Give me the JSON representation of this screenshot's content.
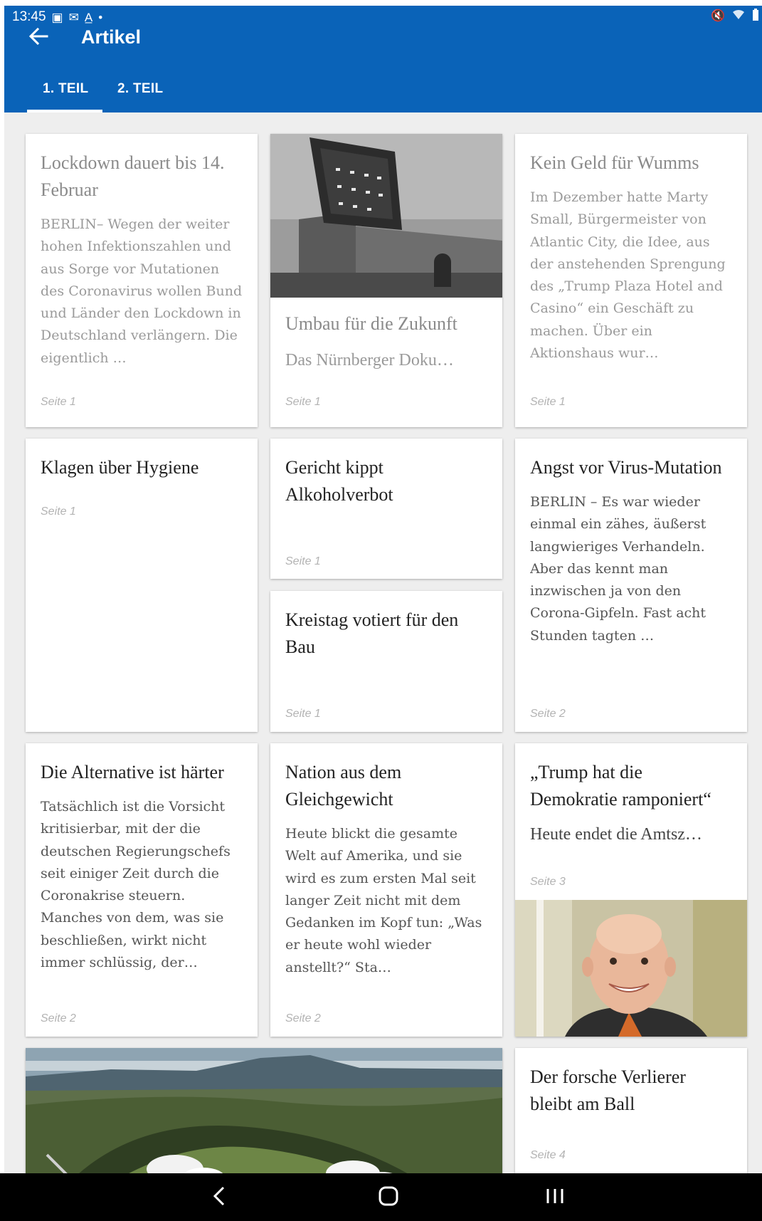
{
  "status_bar": {
    "time": "13:45",
    "left_icons": [
      "image-icon",
      "mail-icon",
      "translate-icon",
      "dot-icon"
    ],
    "right_icons": [
      "mute-icon",
      "wifi-icon",
      "battery-icon"
    ]
  },
  "app_bar": {
    "title": "Artikel",
    "tabs": [
      {
        "label": "1. TEIL",
        "active": true
      },
      {
        "label": "2. TEIL",
        "active": false
      }
    ],
    "color": "#0a63b8"
  },
  "articles": [
    {
      "title": "Lockdown dauert bis 14. Februar",
      "teaser": "BERLIN– Wegen der weiter hohen Infektionszahlen und aus Sorge vor Mutationen des Coronavirus wollen Bund und Länder den Lockdown in Deutschland verlängern. Die eigentlich …",
      "page": "Seite 1"
    },
    {
      "title": "Umbau für die Zukunft",
      "teaser": "Das Nürnberger Doku…",
      "page": "Seite 1",
      "image": "building-photo"
    },
    {
      "title": "Kein Geld für Wumms",
      "teaser": "Im Dezember hatte Marty Small, Bürgermeister von Atlantic City, die Idee, aus der anstehenden Sprengung des „Trump Plaza Hotel and Casino“ ein Geschäft zu machen. Über ein Aktionshaus wur…",
      "page": "Seite 1"
    },
    {
      "title": "Klagen über Hygiene",
      "page": "Seite 1"
    },
    {
      "title": "Gericht kippt Alkoholverbot",
      "page": "Seite 1"
    },
    {
      "title": "Kreistag votiert für den Bau",
      "page": "Seite 1"
    },
    {
      "title": "Angst vor Virus-Mutation",
      "teaser": "BERLIN – Es war wieder einmal ein zähes, äußerst langwieriges Verhandeln. Aber das kennt man inzwischen ja von den Corona-Gipfeln. Fast acht Stunden tagten …",
      "page": "Seite 2"
    },
    {
      "title": "Die Alternative ist härter",
      "teaser": "Tatsächlich ist die Vorsicht kritisierbar, mit der die deutschen Regierungschefs seit einiger Zeit durch die Coronakrise steuern. Manches von dem, was sie beschließen, wirkt nicht immer schlüssig, der…",
      "page": "Seite 2"
    },
    {
      "title": "Nation aus dem Gleichgewicht",
      "teaser": "Heute blickt die gesamte Welt auf Amerika, und sie wird es zum ersten Mal seit langer Zeit nicht mit dem Gedanken im Kopf tun: „Was er heute wohl wieder anstellt?“ Sta…",
      "page": "Seite 2"
    },
    {
      "title": "„Trump hat die Demokratie ramponiert“",
      "teaser": "Heute endet die Amtsz…",
      "page": "Seite 3",
      "image": "portrait-photo"
    },
    {
      "image": "landscape-photo"
    },
    {
      "title": "Der forsche Verlierer bleibt am Ball",
      "page": "Seite 4"
    }
  ],
  "nav_bar": {
    "buttons": [
      "back-nav-icon",
      "home-nav-icon",
      "recents-nav-icon"
    ]
  }
}
